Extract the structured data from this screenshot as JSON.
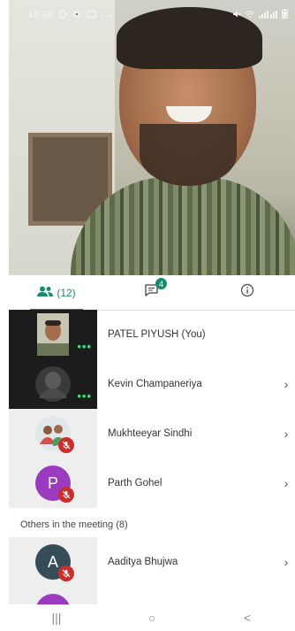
{
  "status_bar": {
    "time": "18:09",
    "icons_left": [
      "whatsapp-icon",
      "settings-icon",
      "message-icon",
      "more-dots-icon"
    ],
    "icons_right": [
      "mute-icon",
      "wifi-icon",
      "signal-icon",
      "battery-icon"
    ]
  },
  "tabs": {
    "people_count": "(12)",
    "chat_badge": "4"
  },
  "participants": [
    {
      "name": "PATEL PIYUSH (You)",
      "thumb": "video",
      "status": "more-dots"
    },
    {
      "name": "Kevin Champaneriya",
      "thumb": "dark-avatar",
      "status": "more-dots"
    },
    {
      "name": "Mukhteeyar Sindhi",
      "thumb": "photo-avatar",
      "status": "mic-off"
    },
    {
      "name": "Parth Gohel",
      "thumb": "letter",
      "letter": "P",
      "avatar_color": "#9b3bbf",
      "status": "mic-off"
    }
  ],
  "others_label": "Others in the meeting (8)",
  "others": [
    {
      "name": "Aaditya Bhujwa",
      "letter": "A",
      "avatar_color": "#364c58",
      "status": "mic-off"
    }
  ],
  "colors": {
    "accent": "#1a8c6e",
    "mic_off": "#c9302c",
    "active_dots": "#3ddc84"
  },
  "navbar": {
    "recents": "|||",
    "home": "○",
    "back": "<"
  }
}
